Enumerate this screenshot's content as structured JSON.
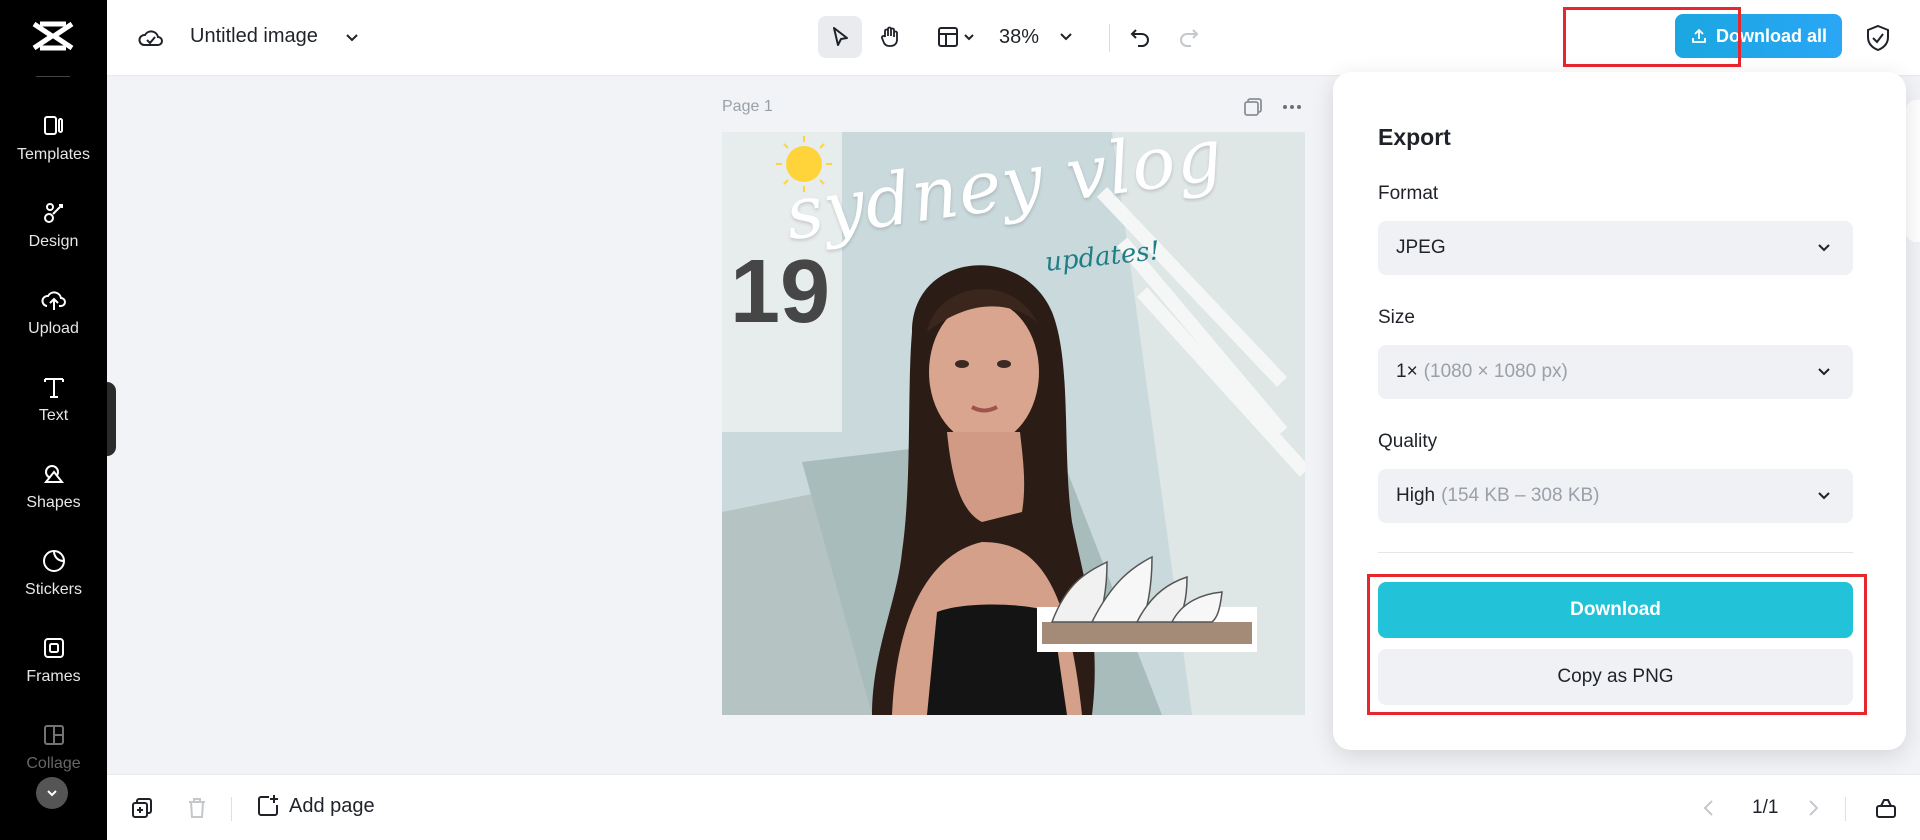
{
  "sidebar": {
    "items": [
      {
        "label": "Templates",
        "icon": "templates-icon"
      },
      {
        "label": "Design",
        "icon": "design-icon"
      },
      {
        "label": "Upload",
        "icon": "upload-icon"
      },
      {
        "label": "Text",
        "icon": "text-icon"
      },
      {
        "label": "Shapes",
        "icon": "shapes-icon"
      },
      {
        "label": "Stickers",
        "icon": "stickers-icon"
      },
      {
        "label": "Frames",
        "icon": "frames-icon"
      },
      {
        "label": "Collage",
        "icon": "collage-icon"
      }
    ]
  },
  "header": {
    "doc_title": "Untitled image",
    "zoom": "38%",
    "download_all_label": "Download all"
  },
  "canvas": {
    "page_label": "Page 1",
    "artwork": {
      "title_text": "sydney vlog",
      "subtitle_text": "updates!"
    }
  },
  "export": {
    "title": "Export",
    "format_label": "Format",
    "format_value": "JPEG",
    "size_label": "Size",
    "size_value": "1×",
    "size_detail": "(1080 × 1080 px)",
    "quality_label": "Quality",
    "quality_value": "High",
    "quality_detail": "(154 KB – 308 KB)",
    "download_label": "Download",
    "copy_label": "Copy as PNG"
  },
  "footer": {
    "add_page_label": "Add page",
    "page_count": "1/1"
  },
  "colors": {
    "accent": "#22c2d9",
    "download_all": "#1aa7e0",
    "highlight_outline": "#e8262e",
    "sidebar_bg": "#000000"
  }
}
